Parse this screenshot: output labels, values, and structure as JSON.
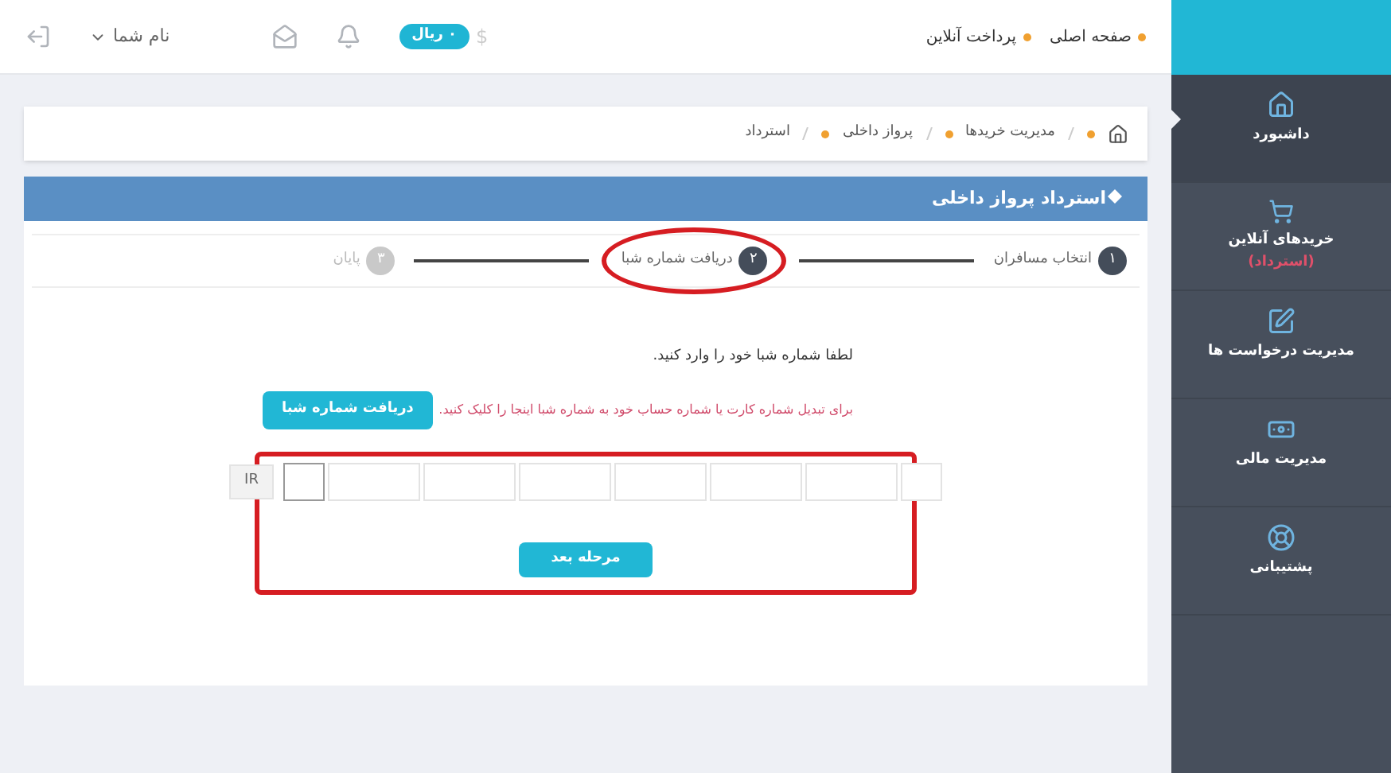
{
  "header": {
    "nav": [
      "صفحه اصلی",
      "پرداخت آنلاین"
    ],
    "currency_symbol": "$",
    "balance": "۰ ریال",
    "user": "نام شما"
  },
  "breadcrumb": [
    "مدیریت خریدها",
    "پرواز داخلی",
    "استرداد"
  ],
  "panel_title": "استرداد پرواز داخلی",
  "steps": [
    {
      "number": "۱",
      "label": "انتخاب مسافران",
      "active": true,
      "circled": false
    },
    {
      "number": "۲",
      "label": "دریافت شماره شبا",
      "active": true,
      "circled": true
    },
    {
      "number": "۳",
      "label": "پایان",
      "active": false,
      "circled": false
    }
  ],
  "instruction": "لطفا شماره شبا خود را وارد کنید.",
  "hint": "برای تبدیل شماره کارت یا شماره حساب خود به شماره شبا اینجا را کلیک کنید.",
  "get_sheba_button": "دریافت شماره شبا",
  "iban_prefix": "IR",
  "iban_fields": [
    {
      "kind": "narrow",
      "focused": false
    },
    {
      "kind": "wide",
      "focused": false
    },
    {
      "kind": "wide",
      "focused": false
    },
    {
      "kind": "wide",
      "focused": false
    },
    {
      "kind": "wide",
      "focused": false
    },
    {
      "kind": "wide",
      "focused": false
    },
    {
      "kind": "wide",
      "focused": false
    },
    {
      "kind": "narrow",
      "focused": true
    }
  ],
  "form_outlined": true,
  "next_button": "مرحله بعد",
  "sidebar": {
    "items": [
      {
        "label": "داشبورد",
        "selected": true
      },
      {
        "label": "خریدهای آنلاین",
        "sublabel": "(استرداد)",
        "selected": false
      },
      {
        "label": "مدیریت درخواست ها",
        "selected": false
      },
      {
        "label": "مدیریت مالی",
        "selected": false
      },
      {
        "label": "پشتیبانی",
        "selected": false
      }
    ]
  }
}
